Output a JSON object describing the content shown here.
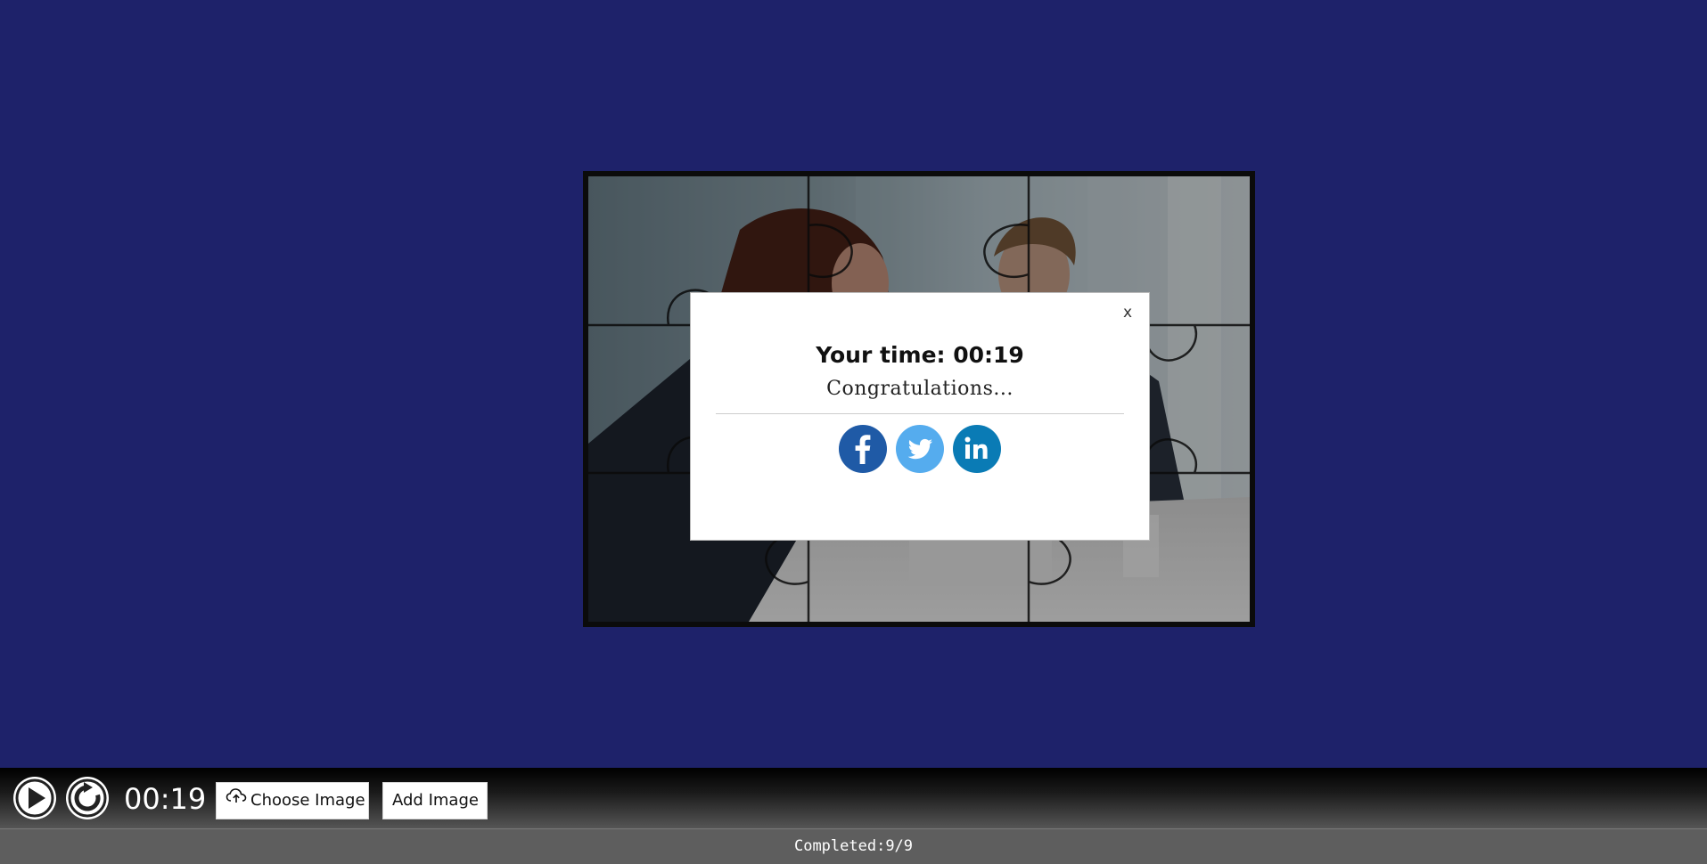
{
  "modal": {
    "close_label": "x",
    "time_text": "Your time: 00:19",
    "congrats_text": "Congratulations...",
    "share": [
      {
        "name": "facebook",
        "icon": "facebook-icon",
        "color": "#1f5aa6"
      },
      {
        "name": "twitter",
        "icon": "twitter-icon",
        "color": "#55acee"
      },
      {
        "name": "linkedin",
        "icon": "linkedin-icon",
        "color": "#0a7bb5"
      }
    ]
  },
  "toolbar": {
    "play_icon": "play-icon",
    "reset_icon": "reset-icon",
    "timer": "00:19",
    "choose_image_label": "Choose Image",
    "choose_image_icon": "cloud-upload-icon",
    "add_image_label": "Add Image"
  },
  "status": {
    "completed_text": "Completed:9/9"
  },
  "colors": {
    "background": "#1e226a",
    "status_bar": "#5e5e5e"
  }
}
